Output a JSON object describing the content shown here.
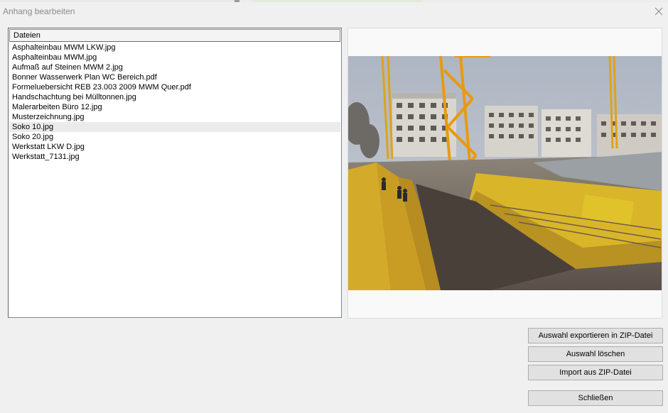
{
  "window": {
    "title": "Anhang bearbeiten"
  },
  "file_list": {
    "header": "Dateien",
    "items": [
      {
        "label": "Asphalteinbau MWM LKW.jpg",
        "selected": false
      },
      {
        "label": "Asphalteinbau MWM.jpg",
        "selected": false
      },
      {
        "label": "Aufmaß auf Steinen MWM 2.jpg",
        "selected": false
      },
      {
        "label": "Bonner Wasserwerk Plan WC Bereich.pdf",
        "selected": false
      },
      {
        "label": "Formeluebersicht REB 23.003 2009 MWM Quer.pdf",
        "selected": false
      },
      {
        "label": "Handschachtung bei Mülltonnen.jpg",
        "selected": false
      },
      {
        "label": "Malerarbeiten Büro 12.jpg",
        "selected": false
      },
      {
        "label": "Musterzeichnung.jpg",
        "selected": false
      },
      {
        "label": "Soko 10.jpg",
        "selected": true
      },
      {
        "label": "Soko 20.jpg",
        "selected": false
      },
      {
        "label": "Werkstatt LKW D.jpg",
        "selected": false
      },
      {
        "label": "Werkstatt_7131.jpg",
        "selected": false
      }
    ]
  },
  "preview": {
    "image_icon": "construction-site-photo"
  },
  "buttons": {
    "export": "Auswahl exportieren in ZIP-Datei",
    "delete": "Auswahl löschen",
    "import": "Import aus ZIP-Datei",
    "close": "Schließen"
  },
  "colors": {
    "window_bg": "#f0f0f0",
    "selected_row": "#ebebeb",
    "button_bg": "#e1e1e1",
    "button_border": "#adadad"
  }
}
